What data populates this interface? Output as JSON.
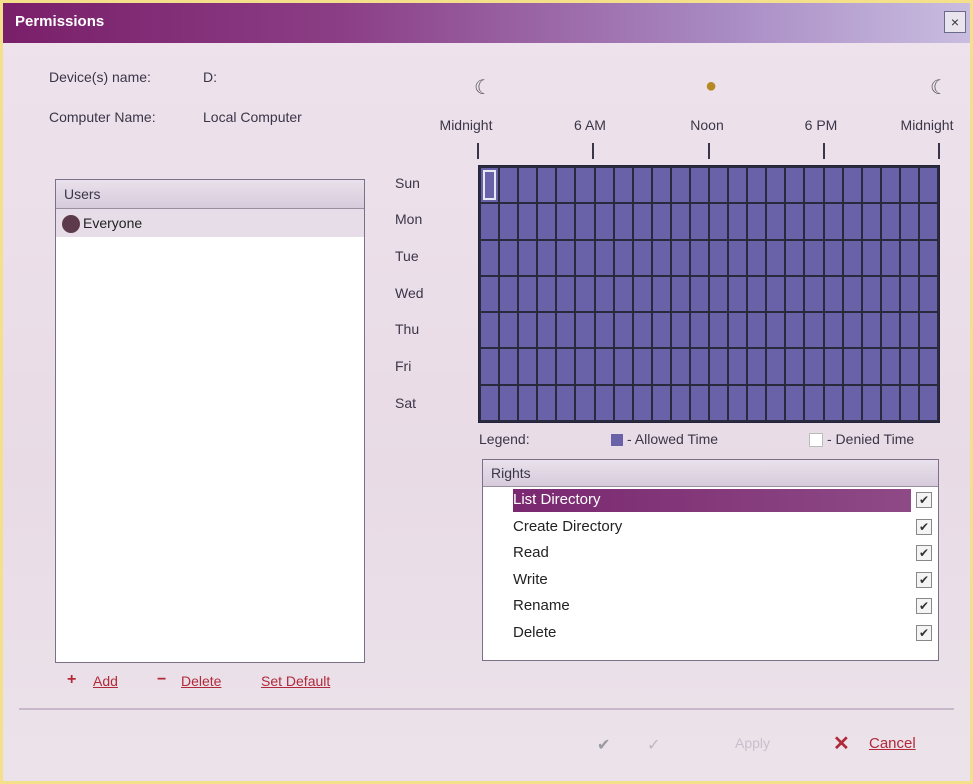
{
  "window": {
    "title": "Permissions",
    "close_glyph": "×"
  },
  "info": {
    "device_label": "Device(s) name:",
    "device_value": "D:",
    "computer_label": "Computer Name:",
    "computer_value": "Local Computer"
  },
  "timeline": {
    "labels": [
      "Midnight",
      "6 AM",
      "Noon",
      "6 PM",
      "Midnight"
    ],
    "icons": [
      "moon-icon",
      "sun-icon",
      "moon-icon"
    ]
  },
  "users": {
    "header": "Users",
    "rows": [
      "Everyone"
    ]
  },
  "days": [
    "Sun",
    "Mon",
    "Tue",
    "Wed",
    "Thu",
    "Fri",
    "Sat"
  ],
  "legend": {
    "label": "Legend:",
    "allowed": "- Allowed Time",
    "denied": "- Denied Time",
    "allowed_color": "#6a62a8",
    "denied_color": "#ffffff"
  },
  "rights": {
    "header": "Rights",
    "items": [
      "List Directory",
      "Create Directory",
      "Read",
      "Write",
      "Rename",
      "Delete"
    ],
    "selected": "List Directory"
  },
  "actions": {
    "add": "Add",
    "delete": "Delete",
    "set_default": "Set Default"
  },
  "footer": {
    "apply": "Apply",
    "cancel": "Cancel"
  },
  "colors": {
    "accent": "#7a2870",
    "grid_allowed": "#6a62a8",
    "link": "#b02a3a"
  }
}
